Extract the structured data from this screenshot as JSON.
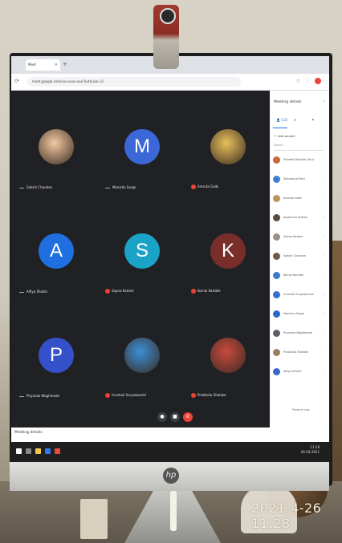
{
  "browser": {
    "tab_label": "Meet",
    "url": "meet.google.com/xxx-xxxx-xxx?authuser=0"
  },
  "meet": {
    "tiles": [
      {
        "name": "Sakshi Chauhan",
        "initial": "",
        "color": "#f2c9a0",
        "photo": true,
        "muted": false
      },
      {
        "name": "Manisha Sarge",
        "initial": "M",
        "color": "#3c67d6",
        "photo": false,
        "muted": false
      },
      {
        "name": "Amruta Gaiki",
        "initial": "",
        "color": "#e8c05a",
        "photo": true,
        "muted": true
      },
      {
        "name": "Alfiya Shaikh",
        "initial": "A",
        "color": "#1f6fe0",
        "photo": false,
        "muted": false
      },
      {
        "name": "Sapna Kadam",
        "initial": "S",
        "color": "#1aa3c7",
        "photo": false,
        "muted": true
      },
      {
        "name": "Komal Kamble",
        "initial": "K",
        "color": "#7a2e2a",
        "photo": false,
        "muted": true
      },
      {
        "name": "Priyanka Waghmode",
        "initial": "P",
        "color": "#3551c9",
        "photo": false,
        "muted": false
      },
      {
        "name": "Vrushali Suryawanshi",
        "initial": "",
        "color": "#3b8fd6",
        "photo": true,
        "muted": true
      },
      {
        "name": "Pratiksha Shelake",
        "initial": "",
        "color": "#c94a3e",
        "photo": true,
        "muted": true
      }
    ],
    "meeting_details_label": "Meeting details"
  },
  "panel": {
    "title": "Meeting details",
    "tab_people": "(12)",
    "add_people_label": "Add people",
    "search_placeholder": "Search",
    "participants": [
      {
        "name": "Sheetal Bhosale (You)",
        "color": "#c9683a"
      },
      {
        "name": "Aishwarya Patil",
        "color": "#3b7fd6"
      },
      {
        "name": "Amruta Gaiki",
        "color": "#b9965a"
      },
      {
        "name": "Jayashree Jadhav",
        "color": "#5a4b3e"
      },
      {
        "name": "Sapna Kadam",
        "color": "#9a8f86"
      },
      {
        "name": "Sakshi Chauhan",
        "color": "#6e5a4a"
      },
      {
        "name": "Komal Kamble",
        "color": "#3f78d0"
      },
      {
        "name": "Vrushali Suryawanshi",
        "color": "#2f6fd1"
      },
      {
        "name": "Manisha Sarge",
        "color": "#2b65cc"
      },
      {
        "name": "Priyanka Waghmode",
        "color": "#5b5f66"
      },
      {
        "name": "Pratiksha Shelake",
        "color": "#9b7e60"
      },
      {
        "name": "Alfiya Shaikh",
        "color": "#3a67c8"
      }
    ],
    "footer_label": "Present now"
  },
  "taskbar": {
    "time": "11:28",
    "date": "26-04-2021"
  },
  "photo": {
    "timestamp": "2021-4-26 11:28",
    "brand": "hp"
  }
}
